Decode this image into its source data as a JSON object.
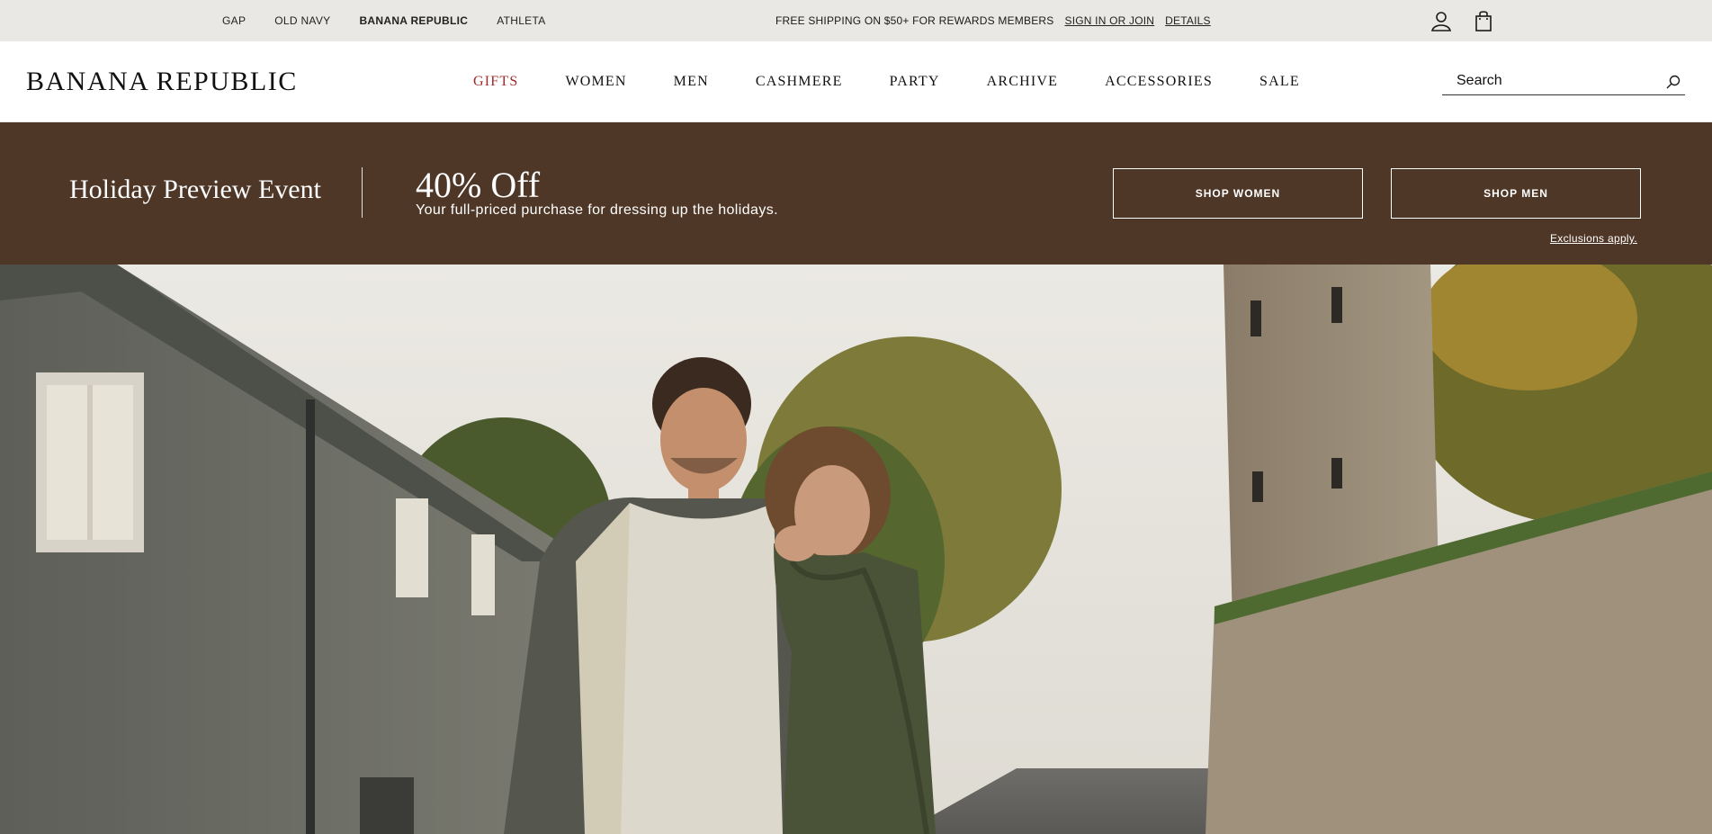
{
  "utility_bar": {
    "brands": [
      "GAP",
      "OLD NAVY",
      "BANANA REPUBLIC",
      "ATHLETA"
    ],
    "active_brand": "BANANA REPUBLIC",
    "promo_text": "FREE SHIPPING ON $50+ FOR REWARDS MEMBERS",
    "sign_in_label": "SIGN IN OR JOIN",
    "details_label": "DETAILS",
    "icons": [
      "account-icon",
      "shopping-bag-icon"
    ]
  },
  "header": {
    "logo": "BANANA REPUBLIC",
    "nav": [
      "GIFTS",
      "WOMEN",
      "MEN",
      "CASHMERE",
      "PARTY",
      "ARCHIVE",
      "ACCESSORIES",
      "SALE"
    ],
    "nav_accent_color": "#9e2a2b",
    "search_placeholder": "Search"
  },
  "banner": {
    "event_title": "Holiday Preview Event",
    "offer": "40% Off",
    "offer_subtext": "Your full-priced purchase for dressing up the holidays.",
    "shop_women_label": "SHOP WOMEN",
    "shop_men_label": "SHOP MEN",
    "exclusions_label": "Exclusions apply.",
    "background_color": "#4f3727"
  },
  "hero": {
    "image_description_icon": "hero-photo"
  }
}
